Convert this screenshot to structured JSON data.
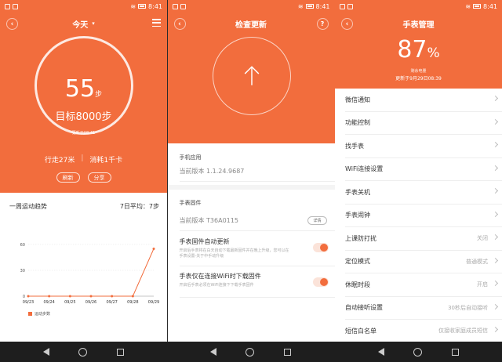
{
  "status_time": "8:41",
  "screen1": {
    "title": "今天",
    "steps": "55",
    "steps_unit": "步",
    "goal": "目标8000步",
    "updated": "更新于08:41",
    "distance": "行走27米",
    "calories": "消耗1千卡",
    "refresh_label": "刷新",
    "share_label": "分享",
    "trend_title": "一周运动趋势",
    "trend_avg": "7日平均：7步",
    "legend": "运动步数"
  },
  "chart_data": {
    "type": "line",
    "categories": [
      "09/23",
      "09/24",
      "09/25",
      "09/26",
      "09/27",
      "09/28",
      "09/29"
    ],
    "series": [
      {
        "name": "运动步数",
        "values": [
          0,
          0,
          0,
          0,
          0,
          0,
          55
        ]
      }
    ],
    "yticks": [
      0,
      30,
      60
    ],
    "ylim": [
      0,
      60
    ],
    "color": "#f26d3d"
  },
  "screen2": {
    "title": "检查更新",
    "help": "?",
    "app_section": "手机应用",
    "app_version": "当前版本 1.1.24.9687",
    "fw_section": "手表固件",
    "fw_version": "当前版本 T36A0115",
    "detail_label": "详情",
    "auto_update_title": "手表固件自动更新",
    "auto_update_desc": "开启后手表将在白天自动下载最新固件并在晚上升级，您可以在手表设置-关于中手动升级",
    "wifi_only_title": "手表仅在连接WiFi时下载固件",
    "wifi_only_desc": "开启后手表必须在WiFi连接下下载手表固件"
  },
  "screen3": {
    "title": "手表管理",
    "battery_pct": "87",
    "pct_sign": "%",
    "battery_label": "剩余电量",
    "battery_updated": "更新于9月29日08:39",
    "items": [
      {
        "label": "微信通知",
        "value": ""
      },
      {
        "label": "功能控制",
        "value": ""
      },
      {
        "label": "找手表",
        "value": ""
      },
      {
        "label": "WiFi连接设置",
        "value": ""
      },
      {
        "label": "手表关机",
        "value": ""
      },
      {
        "label": "手表闹钟",
        "value": ""
      },
      {
        "label": "上课防打扰",
        "value": "关闭"
      },
      {
        "label": "定位模式",
        "value": "普通模式"
      },
      {
        "label": "休眠时段",
        "value": "开启"
      },
      {
        "label": "自动接听设置",
        "value": "30秒后自动接听"
      },
      {
        "label": "短信白名单",
        "value": "仅接收家庭成员短信"
      }
    ]
  },
  "colors": {
    "accent": "#f26d3d"
  }
}
